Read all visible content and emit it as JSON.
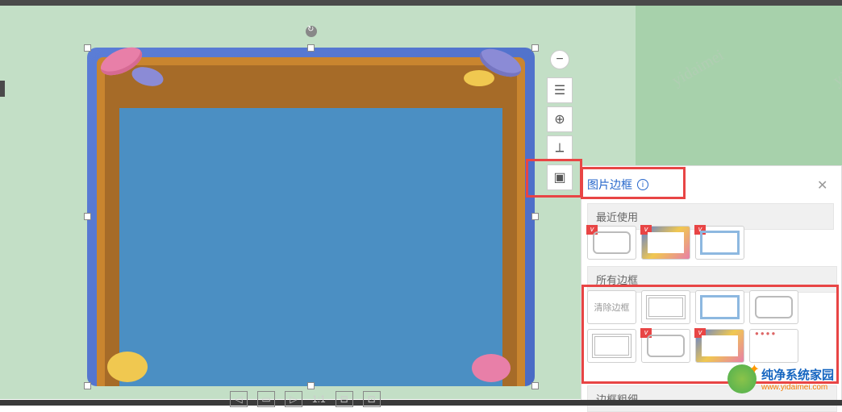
{
  "panel": {
    "title": "图片边框",
    "section_recent": "最近使用",
    "section_all": "所有边框",
    "section_thickness": "边框粗细",
    "clear_frame": "清除边框"
  },
  "toolbar": {
    "minus": "−",
    "text_tool": "☰",
    "zoom_tool": "⊕",
    "crop_tool": "⟂",
    "frame_tool": "▣"
  },
  "zoom": {
    "ratio": "1:1"
  },
  "watermark": {
    "title": "纯净系统家园",
    "url": "www.yidaimei.com"
  },
  "icons": {
    "close": "✕",
    "info": "i"
  }
}
